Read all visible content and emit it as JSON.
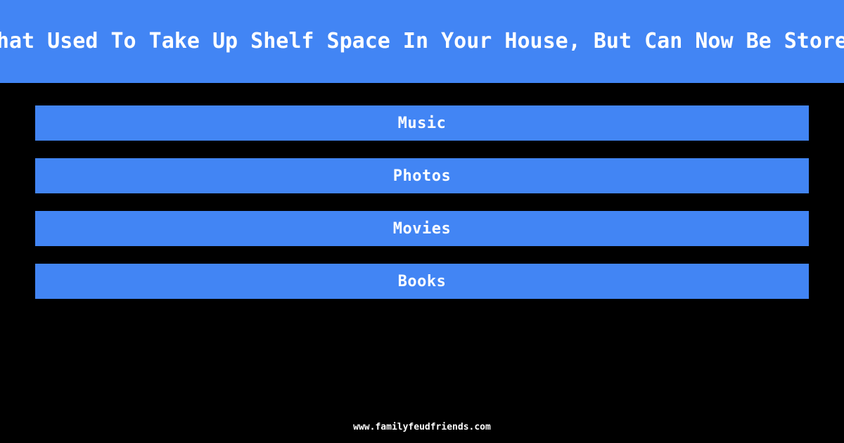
{
  "header": {
    "question_visible": "ng That Used To Take Up Shelf Space In Your House, But Can Now Be Stored El",
    "band_color": "#4285f4",
    "text_color": "#ffffff"
  },
  "answers": {
    "items": [
      {
        "label": "Music"
      },
      {
        "label": "Photos"
      },
      {
        "label": "Movies"
      },
      {
        "label": "Books"
      }
    ],
    "bar_color": "#4285f4",
    "text_color": "#ffffff"
  },
  "footer": {
    "site": "www.familyfeudfriends.com"
  },
  "background_color": "#000000"
}
